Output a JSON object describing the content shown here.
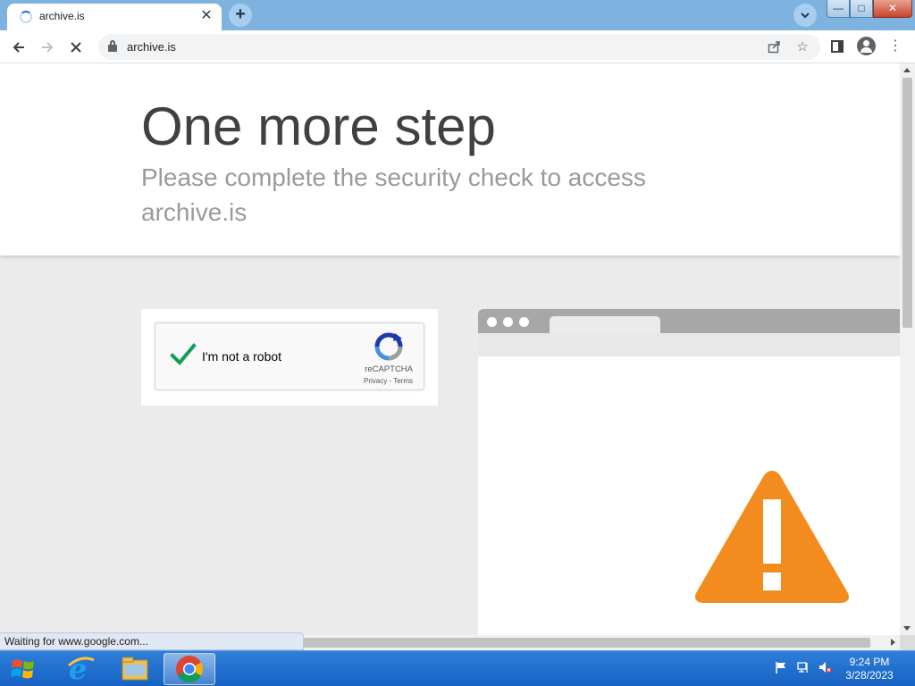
{
  "browser": {
    "tab_title": "archive.is",
    "new_tab_symbol": "+",
    "url": "archive.is",
    "window_controls": {
      "minimize": "—",
      "maximize": "□",
      "close": "✕"
    }
  },
  "page": {
    "title": "One more step",
    "subtitle": "Please complete the security check to access archive.is"
  },
  "captcha": {
    "label": "I'm not a robot",
    "brand": "reCAPTCHA",
    "links": "Privacy - Terms",
    "checked": true
  },
  "status_bar": {
    "text": "Waiting for www.google.com..."
  },
  "taskbar": {
    "time": "9:24 PM",
    "date": "3/28/2023",
    "apps": [
      "start-orb-icon",
      "internet-explorer-icon",
      "file-explorer-icon",
      "chrome-icon"
    ]
  },
  "colors": {
    "tabstrip": "#7eb3e0",
    "warning_orange": "#f28c1f",
    "check_green": "#0f9d58",
    "taskbar": "#1662c4"
  }
}
